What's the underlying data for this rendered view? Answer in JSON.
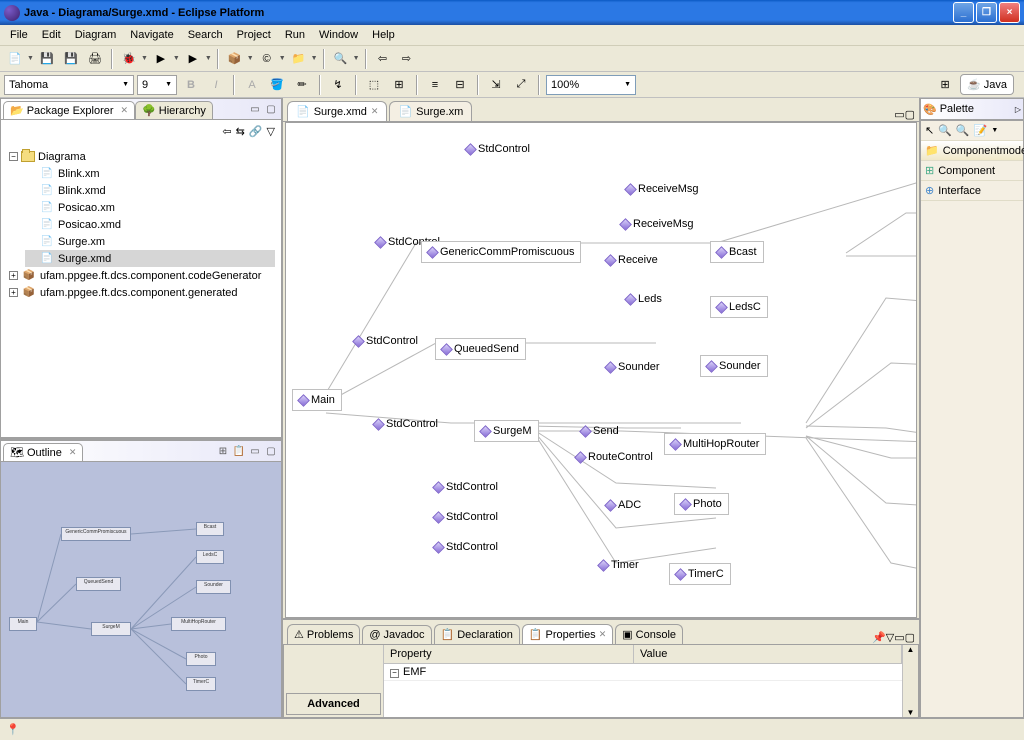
{
  "window": {
    "title": "Java - Diagrama/Surge.xmd - Eclipse Platform"
  },
  "menu": {
    "file": "File",
    "edit": "Edit",
    "diagram": "Diagram",
    "navigate": "Navigate",
    "search": "Search",
    "project": "Project",
    "run": "Run",
    "window": "Window",
    "help": "Help"
  },
  "toolbar2": {
    "font": "Tahoma",
    "size": "9",
    "zoom": "100%"
  },
  "perspective": {
    "java": "Java"
  },
  "packageExplorer": {
    "title": "Package Explorer",
    "hierarchyTab": "Hierarchy",
    "project": "Diagrama",
    "files": [
      "Blink.xm",
      "Blink.xmd",
      "Posicao.xm",
      "Posicao.xmd",
      "Surge.xm",
      "Surge.xmd"
    ],
    "pkg1": "ufam.ppgee.ft.dcs.component.codeGenerator",
    "pkg2": "ufam.ppgee.ft.dcs.component.generated"
  },
  "outline": {
    "title": "Outline"
  },
  "editor": {
    "tabs": [
      "Surge.xmd",
      "Surge.xm"
    ],
    "nodes": {
      "main": "Main",
      "genericComm": "GenericCommPromiscuous",
      "queuedSend": "QueuedSend",
      "surgeM": "SurgeM",
      "bcast": "Bcast",
      "ledsC": "LedsC",
      "sounder": "Sounder",
      "multiHopRouter": "MultiHopRouter",
      "photo": "Photo",
      "timerC": "TimerC"
    },
    "interfaces": {
      "stdControl": "StdControl",
      "receiveMsg": "ReceiveMsg",
      "receive": "Receive",
      "leds": "Leds",
      "sounderIf": "Sounder",
      "send": "Send",
      "routeControl": "RouteControl",
      "adc": "ADC",
      "timer": "Timer"
    }
  },
  "palette": {
    "title": "Palette",
    "group": "Componentmodel",
    "component": "Component",
    "interface": "Interface"
  },
  "bottomTabs": {
    "problems": "Problems",
    "javadoc": "Javadoc",
    "declaration": "Declaration",
    "properties": "Properties",
    "console": "Console"
  },
  "properties": {
    "advanced": "Advanced",
    "propCol": "Property",
    "valCol": "Value",
    "group": "EMF"
  }
}
